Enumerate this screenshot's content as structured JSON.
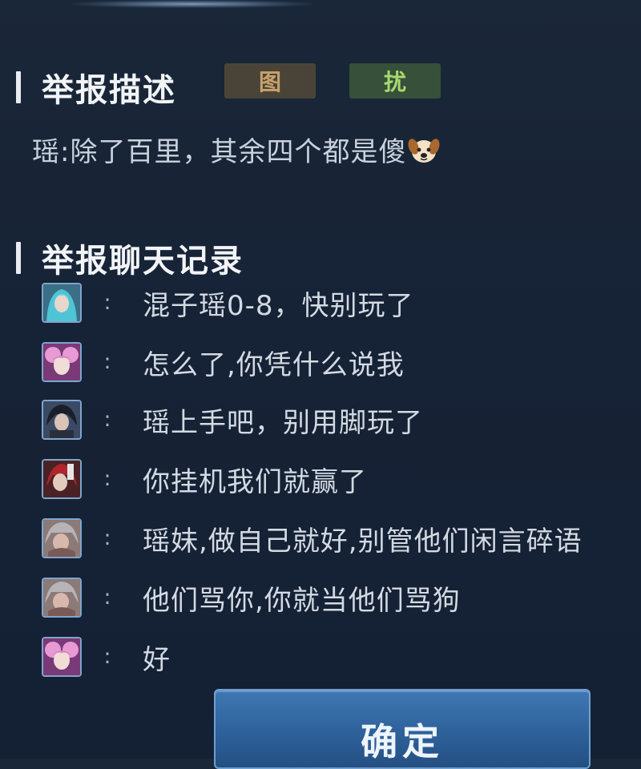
{
  "report_description": {
    "title": "举报描述",
    "tags": [
      {
        "label": "图",
        "color": "#c8a26a",
        "bg": "#4a4438"
      },
      {
        "label": "扰",
        "color": "#a8d870",
        "bg": "#36503a"
      }
    ],
    "text": "瑶:除了百里，其余四个都是傻",
    "emoji": "dog-face-icon"
  },
  "chat_log": {
    "title": "举报聊天记录",
    "messages": [
      {
        "avatar": "avatar-cyan-hair",
        "separator": ":",
        "text": "混子瑶0-8，快别玩了"
      },
      {
        "avatar": "avatar-pink-hair",
        "separator": ":",
        "text": "怎么了,你凭什么说我"
      },
      {
        "avatar": "avatar-dark-hair",
        "separator": ":",
        "text": "瑶上手吧，别用脚玩了"
      },
      {
        "avatar": "avatar-red-hair",
        "separator": ":",
        "text": "你挂机我们就赢了"
      },
      {
        "avatar": "avatar-grey-hair",
        "separator": ":",
        "text": "瑶妹,做自己就好,别管他们闲言碎语"
      },
      {
        "avatar": "avatar-grey-hair-2",
        "separator": ":",
        "text": "他们骂你,你就当他们骂狗"
      },
      {
        "avatar": "avatar-pink-hair-2",
        "separator": ":",
        "text": "好"
      }
    ]
  },
  "confirm_button": {
    "label": "确定"
  }
}
